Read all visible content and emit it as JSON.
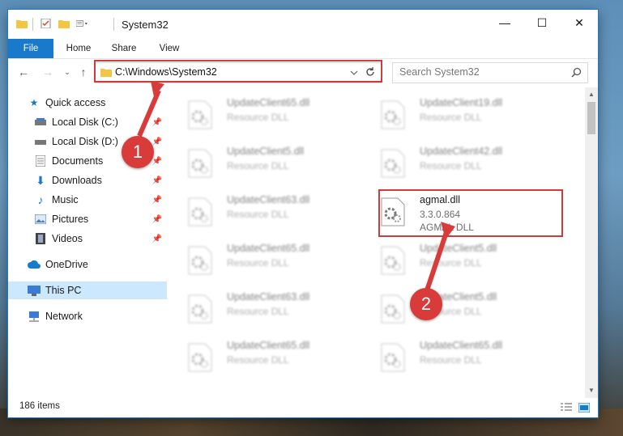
{
  "window": {
    "title": "System32",
    "controls": {
      "minimize": "—",
      "maximize": "☐",
      "close": "✕"
    }
  },
  "ribbon": {
    "tabs": [
      "File",
      "Home",
      "Share",
      "View"
    ],
    "help_label": "?"
  },
  "address": {
    "path": "C:\\Windows\\System32",
    "search_placeholder": "Search System32"
  },
  "sidebar": {
    "quick_access": "Quick access",
    "items": [
      {
        "label": "Local Disk (C:)",
        "icon": "drive-icon"
      },
      {
        "label": "Local Disk (D:)",
        "icon": "drive-icon"
      },
      {
        "label": "Documents",
        "icon": "documents-icon"
      },
      {
        "label": "Downloads",
        "icon": "downloads-icon"
      },
      {
        "label": "Music",
        "icon": "music-icon"
      },
      {
        "label": "Pictures",
        "icon": "pictures-icon"
      },
      {
        "label": "Videos",
        "icon": "videos-icon"
      }
    ],
    "onedrive": "OneDrive",
    "this_pc": "This PC",
    "network": "Network"
  },
  "files": {
    "left_column": [
      {
        "name": "UpdateClient65.dll",
        "desc": "Resource DLL"
      },
      {
        "name": "UpdateClient5.dll",
        "desc": "Resource DLL"
      },
      {
        "name": "UpdateClient63.dll",
        "desc": "Resource DLL"
      },
      {
        "name": "UpdateClient65.dll",
        "desc": "Resource DLL"
      },
      {
        "name": "UpdateClient63.dll",
        "desc": "Resource DLL"
      },
      {
        "name": "UpdateClient65.dll",
        "desc": "Resource DLL"
      }
    ],
    "right_column": [
      {
        "name": "UpdateClient19.dll",
        "desc": "Resource DLL"
      },
      {
        "name": "UpdateClient42.dll",
        "desc": "Resource DLL"
      },
      {
        "name": "agmal.dll",
        "desc": "3.3.0.864",
        "desc2": "AGMAL DLL"
      },
      {
        "name": "UpdateClient5.dll",
        "desc": "Resource DLL"
      },
      {
        "name": "UpdateClient5.dll",
        "desc": "Resource DLL"
      },
      {
        "name": "UpdateClient65.dll",
        "desc": "Resource DLL"
      }
    ]
  },
  "status": {
    "item_count": "186 items"
  },
  "annotations": {
    "step1": "1",
    "step2": "2"
  },
  "colors": {
    "accent": "#1979ca",
    "annotation": "#d93a3a",
    "selection": "#cce8ff"
  }
}
